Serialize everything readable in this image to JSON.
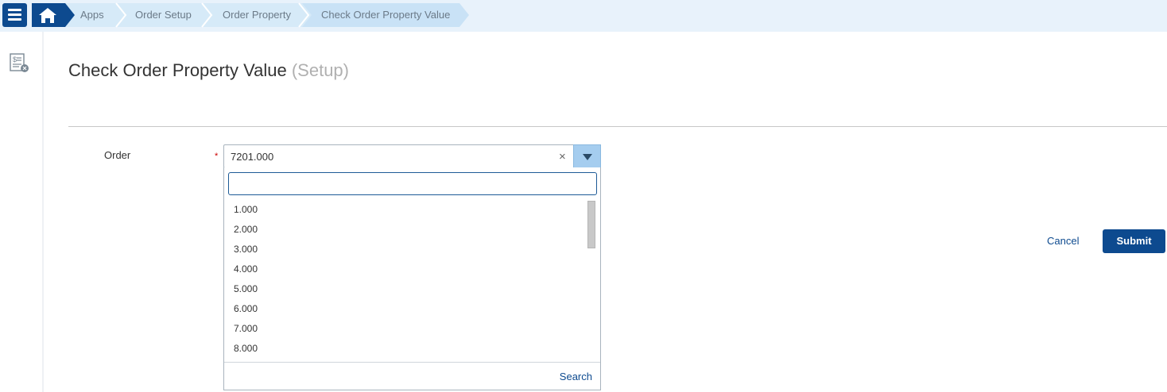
{
  "breadcrumb": {
    "items": [
      {
        "label": "Apps"
      },
      {
        "label": "Order Setup"
      },
      {
        "label": "Order Property"
      },
      {
        "label": "Check Order Property Value"
      }
    ]
  },
  "icons": {
    "menu": "hamburger-menu-icon",
    "home": "home-icon",
    "rail": "price-list-icon",
    "clear": "clear-x-icon",
    "dropdown": "chevron-down-icon"
  },
  "page": {
    "title": "Check Order Property Value",
    "title_suffix": "(Setup)"
  },
  "form": {
    "order_label": "Order",
    "required_mark": "*",
    "order_value": "7201.000",
    "clear_symbol": "×",
    "dropdown": {
      "search_value": "",
      "options": [
        "1.000",
        "2.000",
        "3.000",
        "4.000",
        "5.000",
        "6.000",
        "7.000",
        "8.000"
      ],
      "search_link": "Search"
    }
  },
  "actions": {
    "cancel": "Cancel",
    "submit": "Submit"
  },
  "colors": {
    "primary": "#0d4a8f",
    "breadcrumb_bg": "#e8f2fb",
    "crumb_bg": "#c9e2f6",
    "dropdown_arrow_bg": "#a5cdef",
    "required": "#cc0000"
  }
}
